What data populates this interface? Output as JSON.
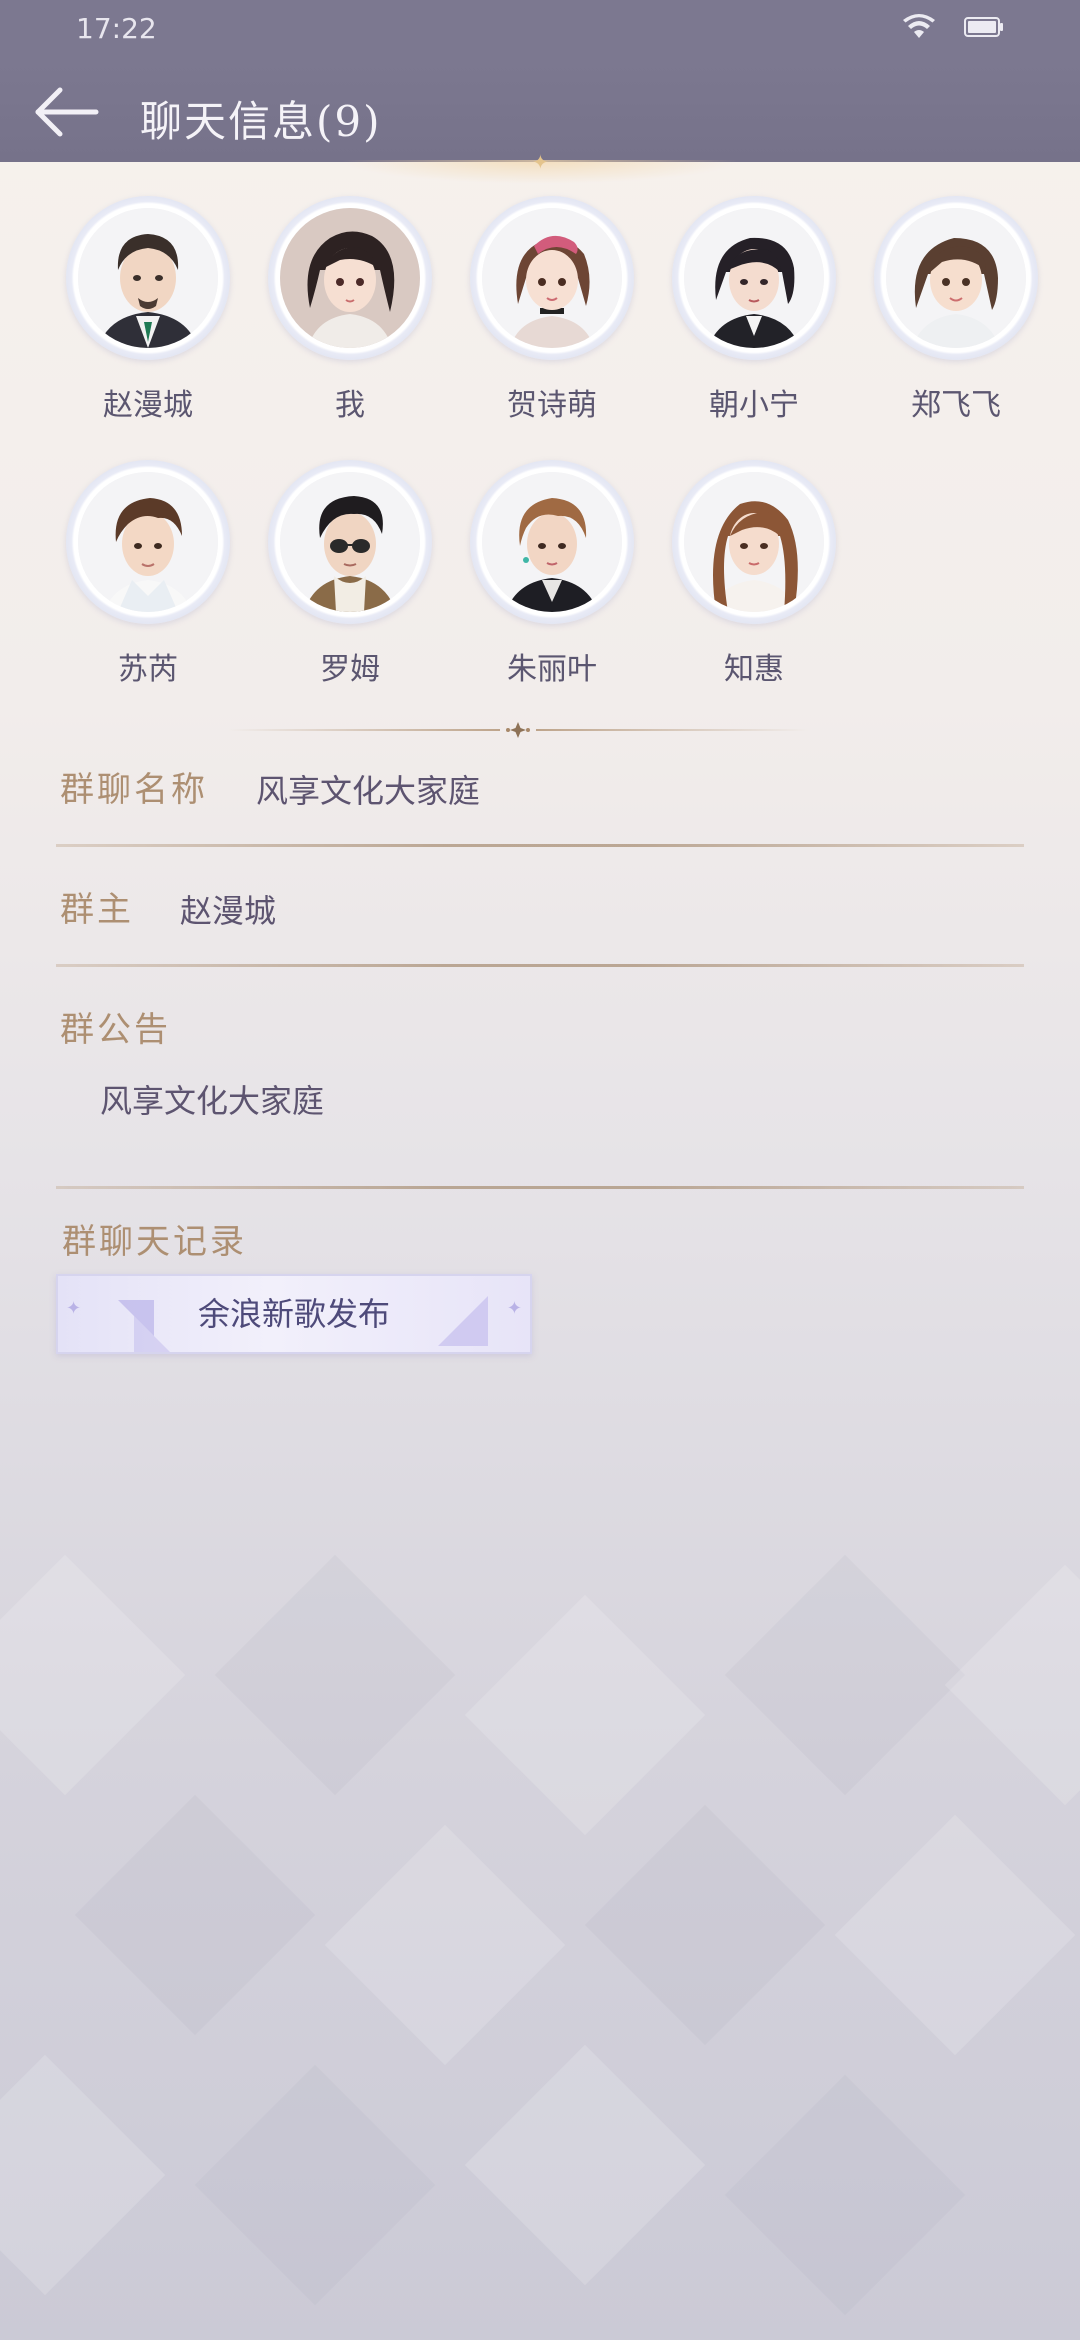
{
  "status_bar": {
    "time": "17:22",
    "icons": [
      "wifi-icon",
      "battery-icon"
    ]
  },
  "header": {
    "back_icon": "back-arrow-icon",
    "title": "聊天信息(9)"
  },
  "members": [
    {
      "name": "赵漫城",
      "avatar": "avatar-man-beard"
    },
    {
      "name": "我",
      "avatar": "avatar-girl-dark-hair"
    },
    {
      "name": "贺诗萌",
      "avatar": "avatar-girl-headband"
    },
    {
      "name": "朝小宁",
      "avatar": "avatar-woman-suit"
    },
    {
      "name": "郑飞飞",
      "avatar": "avatar-woman-bob"
    },
    {
      "name": "苏芮",
      "avatar": "avatar-young-man"
    },
    {
      "name": "罗姆",
      "avatar": "avatar-man-sunglasses"
    },
    {
      "name": "朱丽叶",
      "avatar": "avatar-woman-short-hair"
    },
    {
      "name": "知惠",
      "avatar": "avatar-woman-long-hair"
    }
  ],
  "group_info": {
    "name_label": "群聊名称",
    "name_value": "风享文化大家庭",
    "owner_label": "群主",
    "owner_value": "赵漫城",
    "notice_label": "群公告",
    "notice_value": "风享文化大家庭",
    "history_label": "群聊天记录",
    "history_item": "余浪新歌发布"
  },
  "colors": {
    "header_bg": "#7c7890",
    "label_gold": "#ad8f72",
    "value_text": "#5d5470",
    "button_text": "#4e4a7a"
  }
}
